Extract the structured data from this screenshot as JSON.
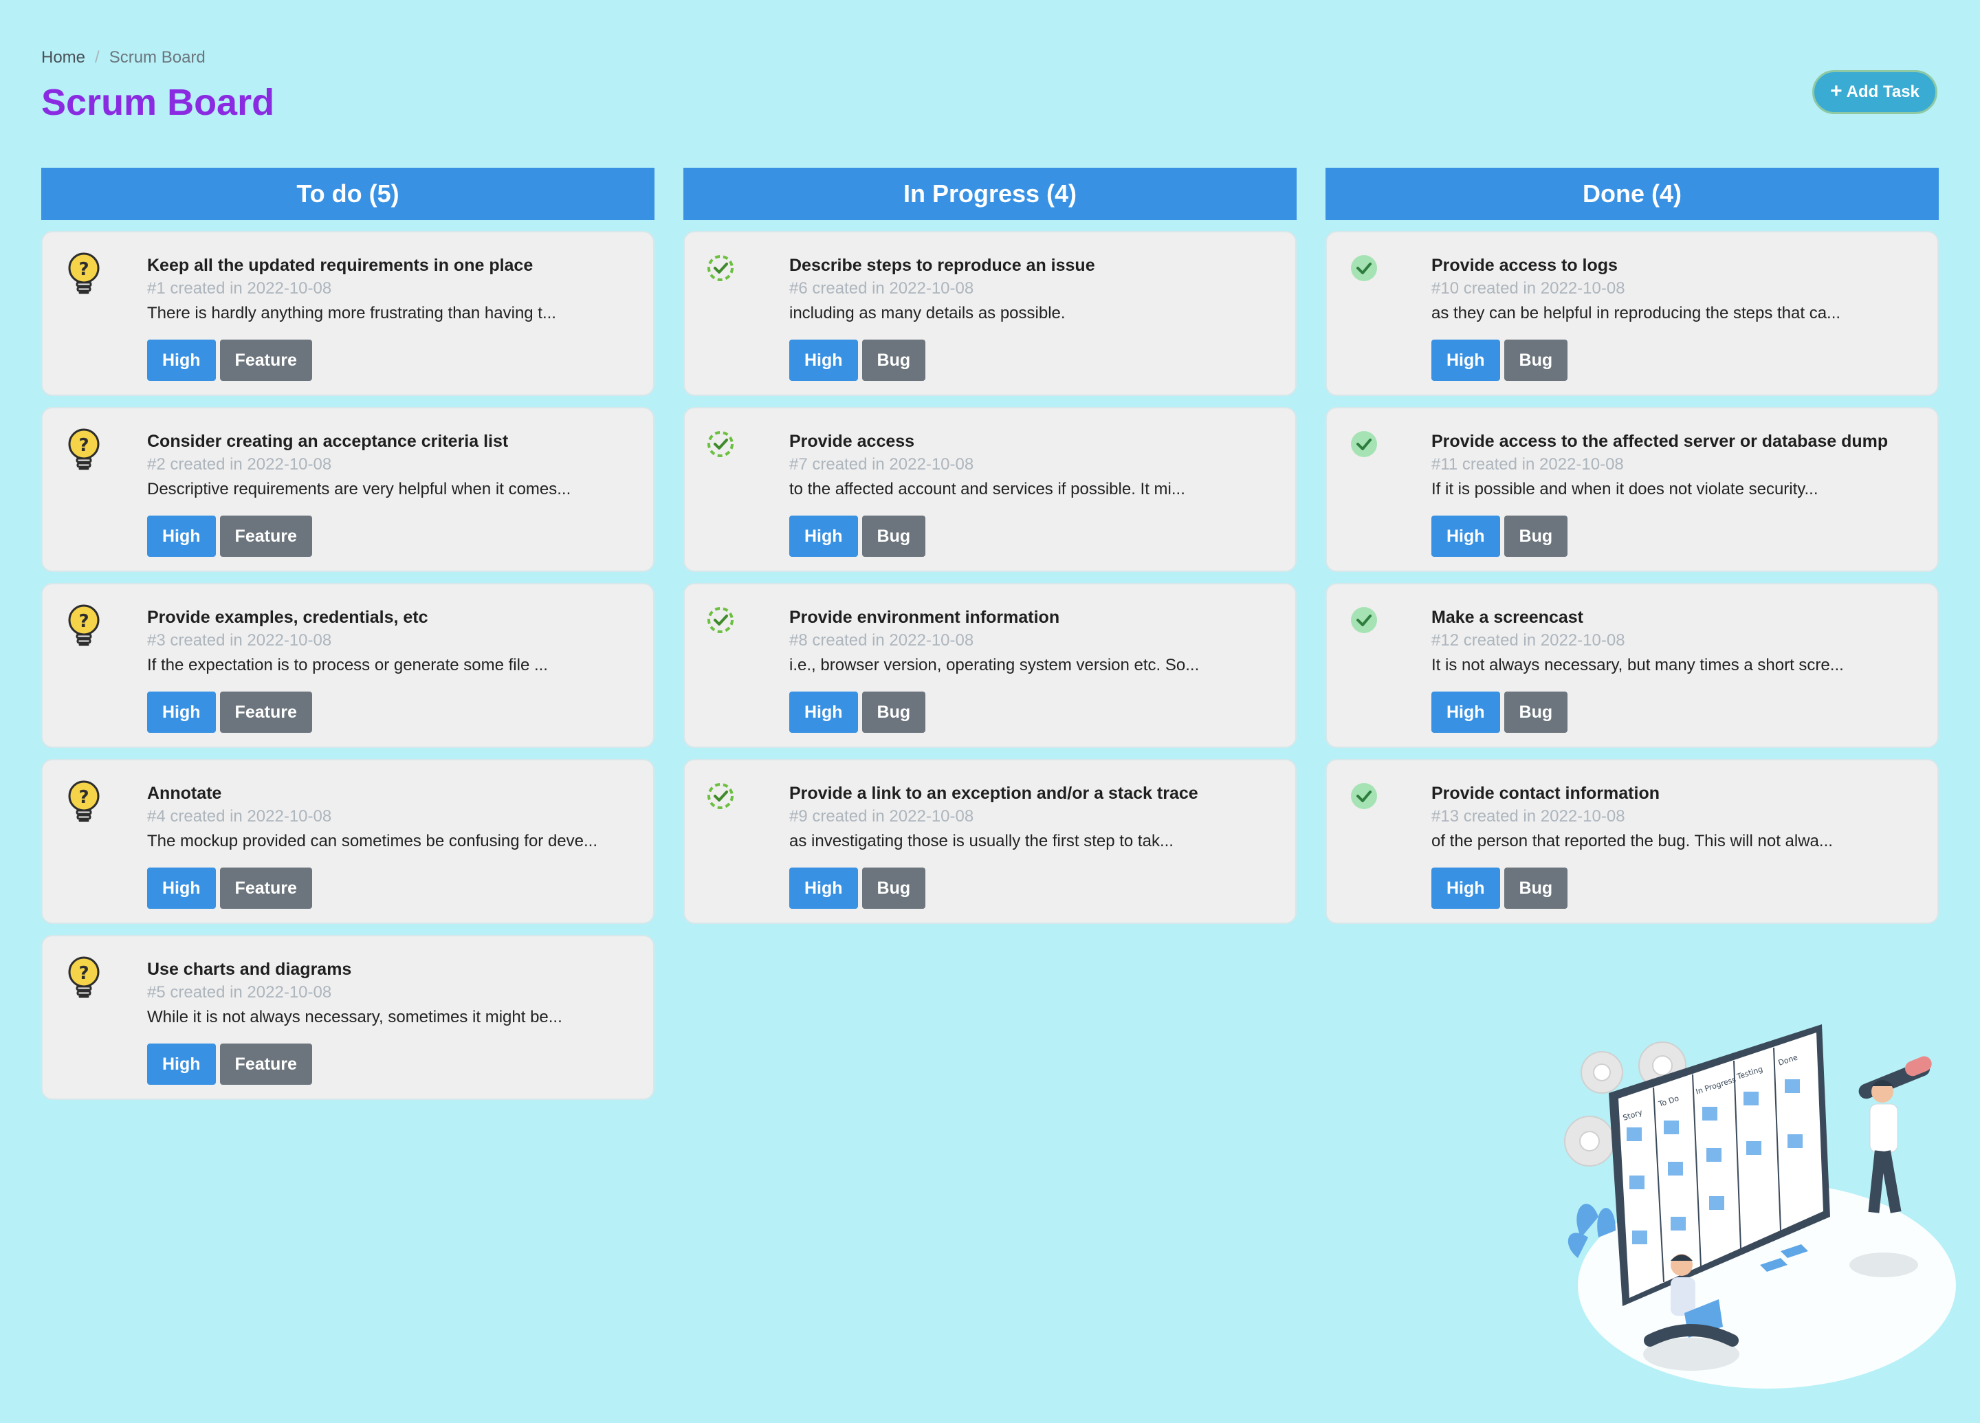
{
  "breadcrumb": {
    "home": "Home",
    "separator": "/",
    "current": "Scrum Board"
  },
  "page_title": "Scrum Board",
  "add_button": {
    "icon": "plus-icon",
    "label": "Add Task"
  },
  "columns": [
    {
      "title": "To do",
      "count": "(5)",
      "icon": "lightbulb-question-icon",
      "cards": [
        {
          "title": "Keep all the updated requirements in one place",
          "meta": "#1 created in 2022-10-08",
          "desc": "There is hardly anything more frustrating than having t...",
          "priority": "High",
          "type": "Feature"
        },
        {
          "title": "Consider creating an acceptance criteria list",
          "meta": "#2 created in 2022-10-08",
          "desc": "Descriptive requirements are very helpful when it comes...",
          "priority": "High",
          "type": "Feature"
        },
        {
          "title": "Provide examples, credentials, etc",
          "meta": "#3 created in 2022-10-08",
          "desc": "If the expectation is to process or generate some file ...",
          "priority": "High",
          "type": "Feature"
        },
        {
          "title": "Annotate",
          "meta": "#4 created in 2022-10-08",
          "desc": "The mockup provided can sometimes be confusing for deve...",
          "priority": "High",
          "type": "Feature"
        },
        {
          "title": "Use charts and diagrams",
          "meta": "#5 created in 2022-10-08",
          "desc": "While it is not always necessary, sometimes it might be...",
          "priority": "High",
          "type": "Feature"
        }
      ]
    },
    {
      "title": "In Progress",
      "count": "(4)",
      "icon": "progress-check-icon",
      "cards": [
        {
          "title": "Describe steps to reproduce an issue",
          "meta": "#6 created in 2022-10-08",
          "desc": "including as many details as possible.",
          "priority": "High",
          "type": "Bug"
        },
        {
          "title": "Provide access",
          "meta": "#7 created in 2022-10-08",
          "desc": "to the affected account and services if possible. It mi...",
          "priority": "High",
          "type": "Bug"
        },
        {
          "title": "Provide environment information",
          "meta": "#8 created in 2022-10-08",
          "desc": "i.e., browser version, operating system version etc. So...",
          "priority": "High",
          "type": "Bug"
        },
        {
          "title": "Provide a link to an exception and/or a stack trace",
          "meta": "#9 created in 2022-10-08",
          "desc": "as investigating those is usually the first step to tak...",
          "priority": "High",
          "type": "Bug"
        }
      ]
    },
    {
      "title": "Done",
      "count": "(4)",
      "icon": "done-check-icon",
      "cards": [
        {
          "title": "Provide access to logs",
          "meta": "#10 created in 2022-10-08",
          "desc": "as they can be helpful in reproducing the steps that ca...",
          "priority": "High",
          "type": "Bug"
        },
        {
          "title": "Provide access to the affected server or database dump",
          "meta": "#11 created in 2022-10-08",
          "desc": "If it is possible and when it does not violate security...",
          "priority": "High",
          "type": "Bug"
        },
        {
          "title": "Make a screencast",
          "meta": "#12 created in 2022-10-08",
          "desc": "It is not always necessary, but many times a short scre...",
          "priority": "High",
          "type": "Bug"
        },
        {
          "title": "Provide contact information",
          "meta": "#13 created in 2022-10-08",
          "desc": "of the person that reported the bug. This will not alwa...",
          "priority": "High",
          "type": "Bug"
        }
      ]
    }
  ],
  "illustration": {
    "name": "scrum-board-illustration-icon",
    "board_labels": [
      "Story",
      "To Do",
      "In Progress",
      "Testing",
      "Done"
    ]
  },
  "colors": {
    "background": "#b7f0f7",
    "title": "#8a2be2",
    "column_header": "#3891e3",
    "priority_tag": "#3891e3",
    "type_tag": "#6c757d",
    "add_button": "#3aabd2"
  }
}
